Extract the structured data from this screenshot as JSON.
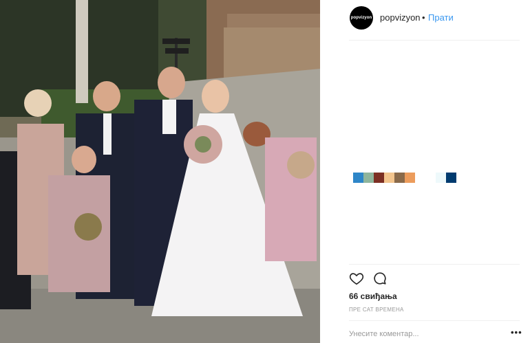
{
  "post": {
    "username": "popvizyon",
    "avatar_text": "popvizyon",
    "separator": "•",
    "follow_label": "Прати",
    "likes_text": "66 свиђања",
    "timestamp": "ПРЕ САТ ВРЕМЕНА",
    "comment_placeholder": "Унесите коментар...",
    "more_label": "•••"
  },
  "icons": {
    "like": "heart-icon",
    "comment": "comment-bubble-icon",
    "more": "more-options-icon"
  },
  "swatch_colors": [
    "#2e86c8",
    "#8fb59c",
    "#7c2f23",
    "#f3c58e",
    "#8a6a4a",
    "#ec9c5c",
    "#ffffff",
    "#ffffff",
    "#eef9fb",
    "#003b6f"
  ],
  "colors": {
    "link": "#3897f0",
    "text": "#262626",
    "muted": "#999999",
    "divider": "#efefef"
  }
}
